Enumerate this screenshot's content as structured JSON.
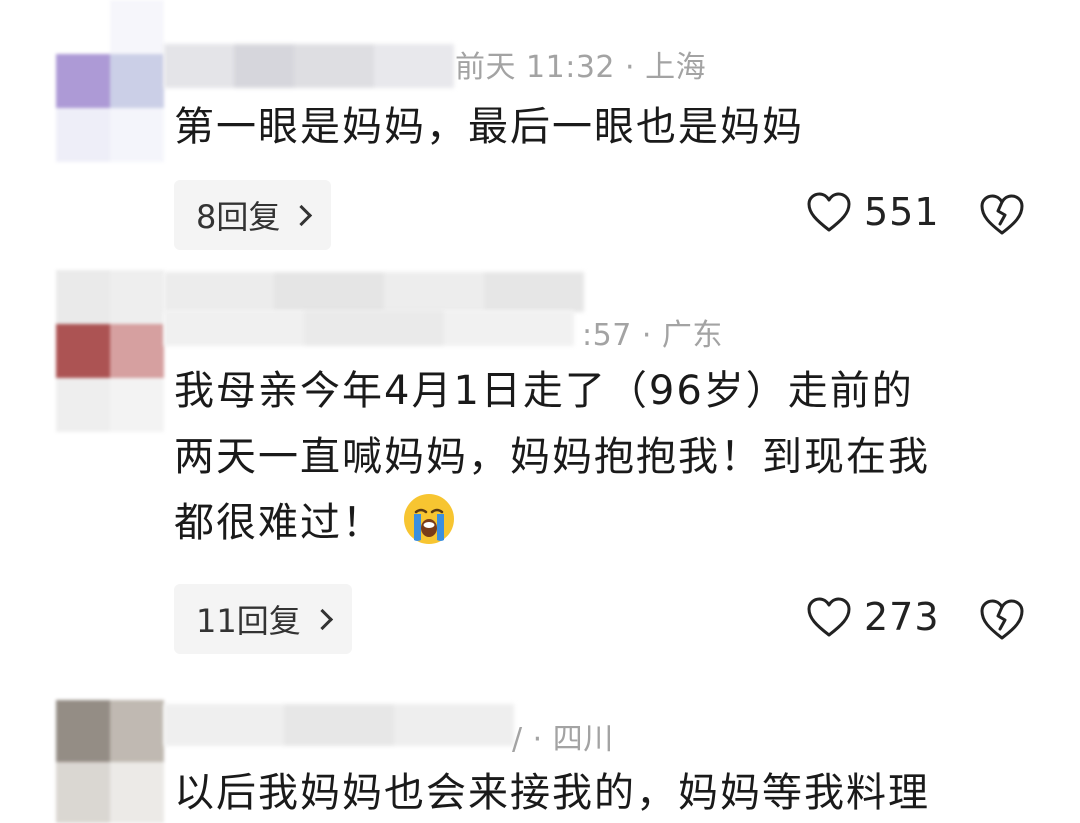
{
  "comments": [
    {
      "meta": "前天 11:32 · 上海",
      "text": [
        "第一眼是妈妈，最后一眼也是妈妈"
      ],
      "replies_label": "8回复",
      "likes": "551",
      "icons": {
        "like": "heart-outline-icon",
        "dislike": "broken-heart-icon",
        "chevron": "chevron-right-icon"
      }
    },
    {
      "meta": ":57 · 广东",
      "text": [
        "我母亲今年4月1日走了（96岁）走前的",
        "两天一直喊妈妈，妈妈抱抱我！到现在我",
        "都很难过！"
      ],
      "emoji": "loudly-crying-face-icon",
      "replies_label": "11回复",
      "likes": "273"
    },
    {
      "meta": "/ · 四川",
      "text": [
        "以后我妈妈也会来接我的，妈妈等我料理"
      ]
    }
  ],
  "colors": {
    "meta_text": "#a3a3a3",
    "reply_bg": "#f4f4f4",
    "body_text": "#1a1a1a",
    "emoji_face": "#f7c531",
    "emoji_tears": "#3b8fe0"
  }
}
